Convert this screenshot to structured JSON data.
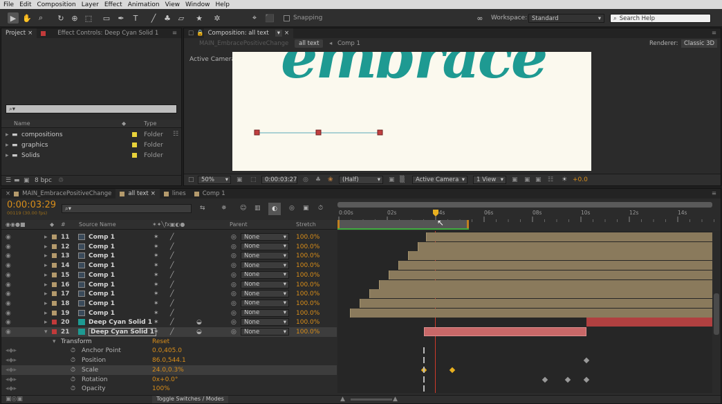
{
  "menu": [
    "File",
    "Edit",
    "Composition",
    "Layer",
    "Effect",
    "Animation",
    "View",
    "Window",
    "Help"
  ],
  "toolbar": {
    "snapping": "Snapping",
    "workspace_label": "Workspace:",
    "workspace": "Standard",
    "search": "Search Help"
  },
  "project_panel": {
    "tabs": [
      "Project",
      "Effect Controls: Deep Cyan Solid 1"
    ],
    "search": "⌕▾",
    "col_name": "Name",
    "col_type": "Type",
    "items": [
      {
        "name": "compositions",
        "type": "Folder"
      },
      {
        "name": "graphics",
        "type": "Folder"
      },
      {
        "name": "Solids",
        "type": "Folder"
      }
    ],
    "bpc": "8 bpc"
  },
  "comp_viewer": {
    "tab": "Composition: all text",
    "crumbs": [
      "MAIN_EmbracePositiveChange",
      "all text",
      "Comp 1"
    ],
    "renderer_label": "Renderer:",
    "renderer": "Classic 3D",
    "camera_label": "Active Camera",
    "canvas_text": "embrace",
    "zoom": "50%",
    "time": "0:00:03:27",
    "resolution": "(Half)",
    "camera": "Active Camera",
    "view": "1 View",
    "exposure": "+0.0"
  },
  "timeline": {
    "tabs": [
      "MAIN_EmbracePositiveChange",
      "all text",
      "lines",
      "Comp 1"
    ],
    "timecode": "0:00:03:29",
    "fps_info": "00119 (30.00 fps)",
    "search": "⌕▾",
    "col_num": "#",
    "col_source": "Source Name",
    "col_parent": "Parent",
    "col_stretch": "Stretch",
    "ruler_labels": [
      "0:00s",
      "02s",
      "04s",
      "06s",
      "08s",
      "10s",
      "12s",
      "14s"
    ],
    "layers": [
      {
        "num": "11",
        "name": "Comp 1",
        "parent": "None",
        "stretch": "100.0%",
        "color": "#b49a6c"
      },
      {
        "num": "12",
        "name": "Comp 1",
        "parent": "None",
        "stretch": "100.0%",
        "color": "#b49a6c"
      },
      {
        "num": "13",
        "name": "Comp 1",
        "parent": "None",
        "stretch": "100.0%",
        "color": "#b49a6c"
      },
      {
        "num": "14",
        "name": "Comp 1",
        "parent": "None",
        "stretch": "100.0%",
        "color": "#b49a6c"
      },
      {
        "num": "15",
        "name": "Comp 1",
        "parent": "None",
        "stretch": "100.0%",
        "color": "#b49a6c"
      },
      {
        "num": "16",
        "name": "Comp 1",
        "parent": "None",
        "stretch": "100.0%",
        "color": "#b49a6c"
      },
      {
        "num": "17",
        "name": "Comp 1",
        "parent": "None",
        "stretch": "100.0%",
        "color": "#b49a6c"
      },
      {
        "num": "18",
        "name": "Comp 1",
        "parent": "None",
        "stretch": "100.0%",
        "color": "#b49a6c"
      },
      {
        "num": "19",
        "name": "Comp 1",
        "parent": "None",
        "stretch": "100.0%",
        "color": "#b49a6c"
      },
      {
        "num": "20",
        "name": "Deep Cyan Solid 1",
        "parent": "None",
        "stretch": "100.0%",
        "color": "#c23a3a"
      },
      {
        "num": "21",
        "name": "Deep Cyan Solid 1",
        "parent": "None",
        "stretch": "100.0%",
        "color": "#c23a3a"
      }
    ],
    "transform_label": "Transform",
    "reset": "Reset",
    "properties": [
      {
        "name": "Anchor Point",
        "value": "0.0,405.0"
      },
      {
        "name": "Position",
        "value": "86.0,544.1"
      },
      {
        "name": "Scale",
        "value": "24.0,0.3%"
      },
      {
        "name": "Rotation",
        "value": "0x+0.0°"
      },
      {
        "name": "Opacity",
        "value": "100%"
      }
    ],
    "toggle": "Toggle Switches / Modes"
  }
}
